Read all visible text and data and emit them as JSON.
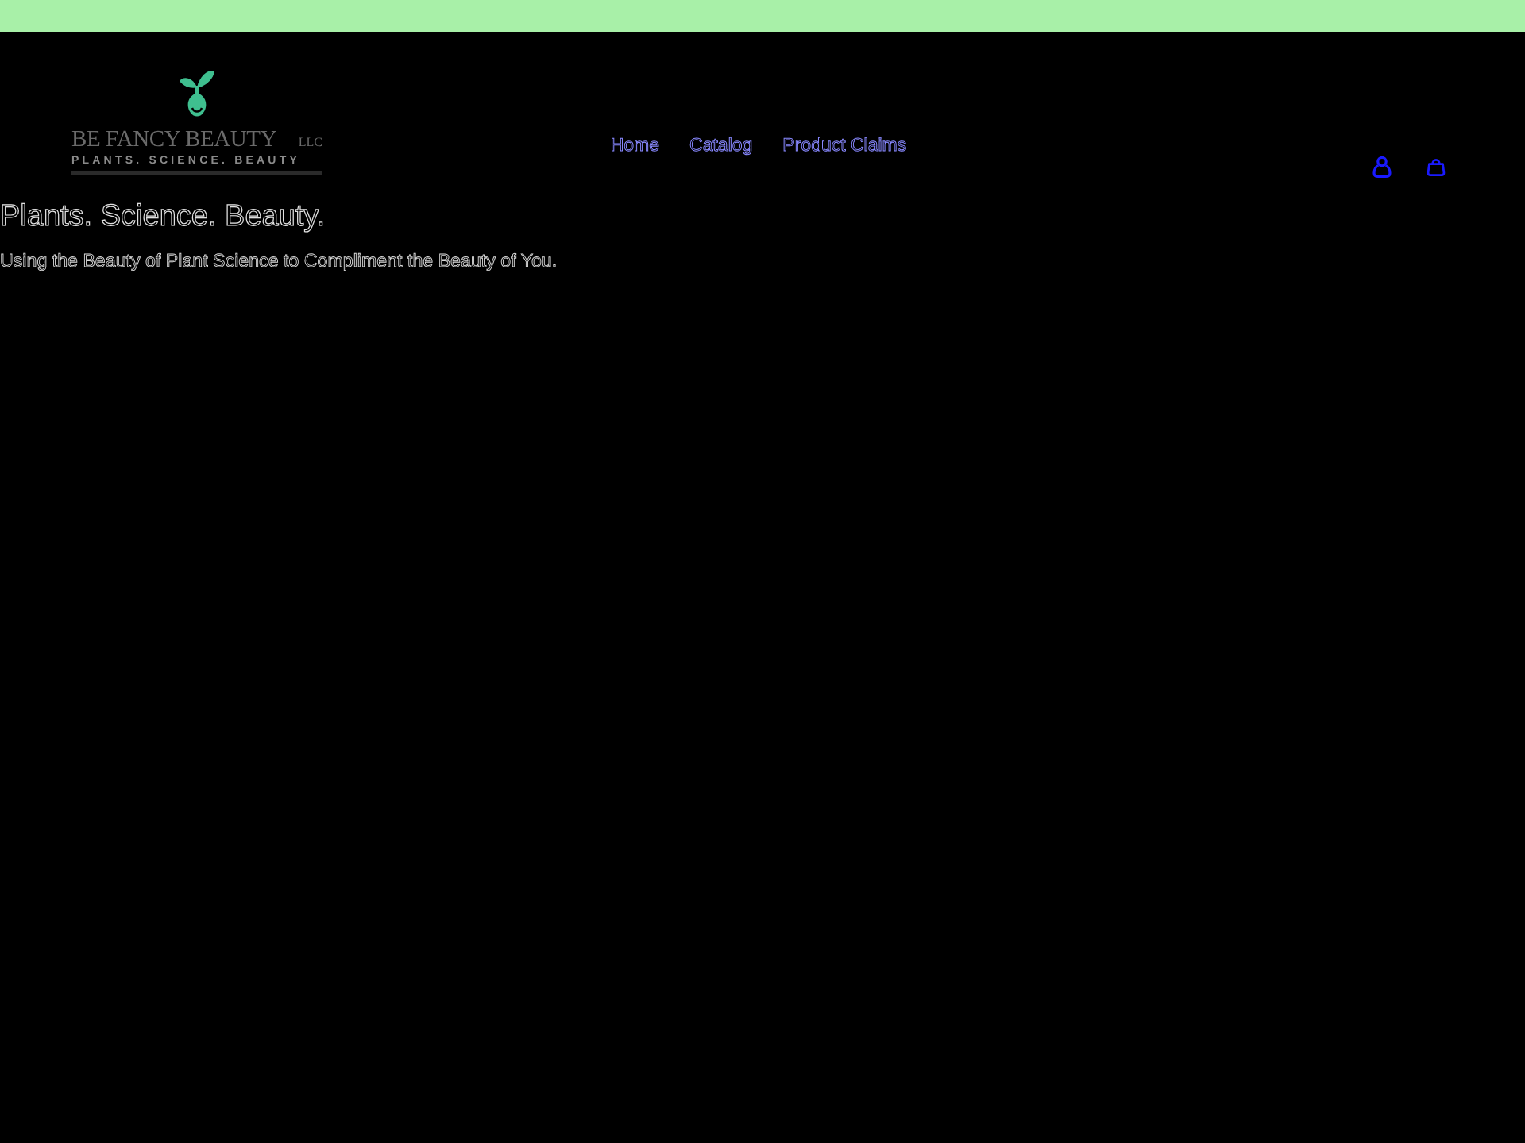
{
  "header": {
    "logo": {
      "name": "BE FANCY BEAUTY",
      "suffix": "LLC",
      "tagline": "PLANTS. SCIENCE. BEAUTY"
    },
    "nav": [
      {
        "label": "Home"
      },
      {
        "label": "Catalog"
      },
      {
        "label": "Product Claims"
      }
    ]
  },
  "hero": {
    "heading": "Plants. Science. Beauty.",
    "text": "Using the Beauty of Plant Science to Compliment the Beauty of You."
  }
}
